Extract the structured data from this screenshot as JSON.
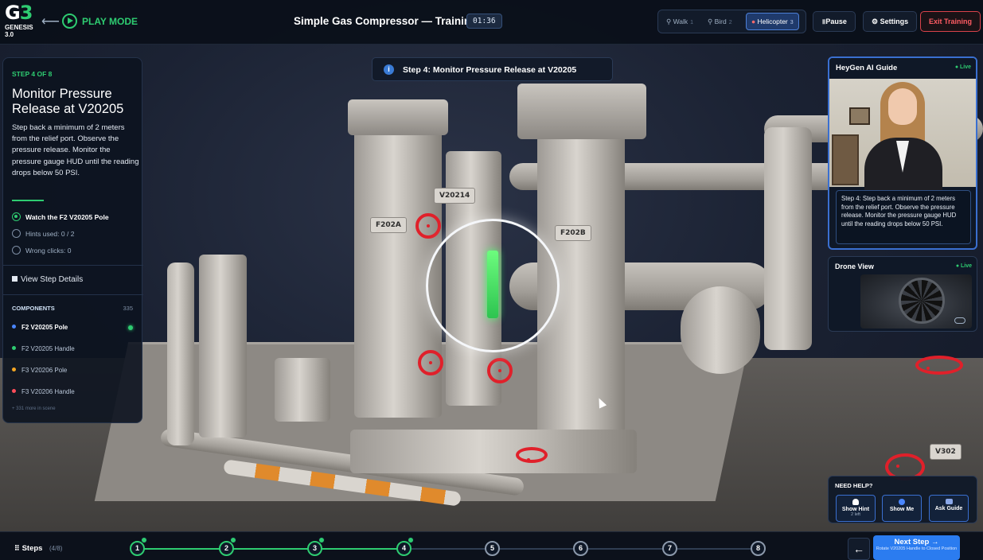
{
  "app": {
    "logo_text": "G",
    "logo_number": "3",
    "logo_sub_line1": "GENESIS",
    "logo_sub_line2": "3.0",
    "mode_label": "PLAY MODE",
    "title": "Simple Gas Compressor — Training",
    "timer": "01:36"
  },
  "camera_modes": [
    {
      "label": "Walk",
      "key": "1",
      "active": false
    },
    {
      "label": "Bird",
      "key": "2",
      "active": false
    },
    {
      "label": "Helicopter",
      "key": "3",
      "active": true
    }
  ],
  "toolbar": {
    "pause_label": "Pause",
    "settings_label": "Settings",
    "exit_label": "Exit Training"
  },
  "step_panel": {
    "step_of": "STEP 4 OF 8",
    "title": "Monitor Pressure Release at V20205",
    "description": "Step back a minimum of 2 meters from the relief port. Observe the pressure release. Monitor the pressure gauge HUD until the reading drops below 50 PSI.",
    "task": "Watch the F2 V20205 Pole",
    "hints_used": "Hints used: 0 / 2",
    "wrong_clicks": "Wrong clicks: 0",
    "view_details_label": "View Step Details"
  },
  "components": {
    "heading": "COMPONENTS",
    "count": "335",
    "items": [
      {
        "label": "F2 V20205 Pole",
        "color": "#4a86ff",
        "selected": true
      },
      {
        "label": "F2 V20205 Handle",
        "color": "#2ecc71",
        "selected": false
      },
      {
        "label": "F3 V20206 Pole",
        "color": "#f5a623",
        "selected": false
      },
      {
        "label": "F3 V20206 Handle",
        "color": "#ff4d5a",
        "selected": false
      }
    ],
    "more": "+ 331 more in scene"
  },
  "banner": {
    "icon": "info-icon",
    "text": "Step 4: Monitor Pressure Release at V20205"
  },
  "scene_tags": {
    "v20214": "V20214",
    "f202a": "F202A",
    "f202b": "F202B",
    "v302": "V302"
  },
  "ai_guide": {
    "title": "HeyGen AI Guide",
    "live": "● Live",
    "caption": "Step 4: Step back a minimum of 2 meters from the relief port. Observe the pressure release. Monitor the pressure gauge HUD until the reading drops below 50 PSI."
  },
  "drone_view": {
    "title": "Drone View",
    "live": "● Live"
  },
  "help": {
    "title": "NEED HELP?",
    "show_hint": "Show Hint",
    "show_hint_sub": "2 left",
    "show_me": "Show Me",
    "ask_guide": "Ask Guide"
  },
  "steps_bar": {
    "label": "Steps",
    "count": "(4/8)",
    "steps": [
      "1",
      "2",
      "3",
      "4",
      "5",
      "6",
      "7",
      "8"
    ],
    "completed": 4,
    "prev_label": "←",
    "next_label": "Next Step →",
    "next_sub": "Rotate V20205 Handle to Closed Position"
  },
  "colors": {
    "accent_green": "#2ecc71",
    "accent_blue": "#2b7cf0",
    "exit_red": "#ff5c63",
    "valve_red": "#e0202a"
  }
}
